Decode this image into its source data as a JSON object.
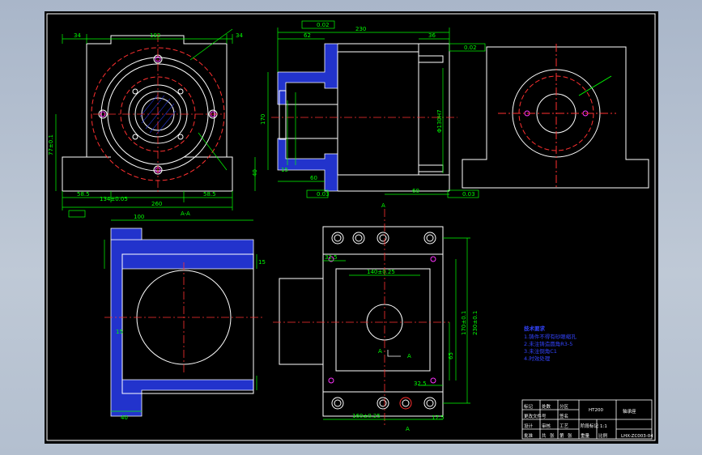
{
  "colors": {
    "background": "#b8c3d1",
    "sheet": "#000000",
    "outline": "#ffffff",
    "dimension": "#00ff00",
    "centerline": "#ff3030",
    "hatch": "#2233cc",
    "notes": "#3344ff",
    "callout": "#ffff00",
    "magenta": "#ff33ff"
  },
  "drawing": {
    "section_label": "A-A",
    "section_marker": "A",
    "front_view": {
      "dims": {
        "top_left": "34",
        "top_mid": "192",
        "top_right": "34",
        "bottom_left": "58.5",
        "bottom_mid": "134±0.05",
        "bottom_right": "58.5",
        "overall": "260",
        "left_height": "77±0.1",
        "right_height": "40"
      }
    },
    "side_view": {
      "dims": {
        "overall": "230",
        "top_left": "62",
        "top_right": "36",
        "bottom_left": "60",
        "bottom_right": "60",
        "small_left": "15",
        "bore": "Φ130H7",
        "left_height": "170"
      },
      "tolerance_top": "0.02",
      "tolerance_bottom_left": "0.03",
      "tolerance_bottom_right": "0.03"
    },
    "section_view": {
      "dims": {
        "top": "100",
        "bottom": "40",
        "side_left": "15",
        "side_right": "15"
      }
    },
    "top_view": {
      "dims": {
        "top_left": "32.5",
        "mid": "140±0.25",
        "bottom_right": "32.5",
        "bottom_mid": "160±0.25",
        "right_a": "170±0.1",
        "right_b": "230±0.1",
        "right_c": "65",
        "bottom_small": "17.5"
      }
    },
    "notes_title": "技术要求",
    "notes": [
      "1.铸件不得有砂眼缩孔",
      "2.未注铸造圆角R3-5",
      "3.未注倒角C1",
      "4.时效处理"
    ]
  },
  "title_block": {
    "part_name": "轴承座",
    "drawing_number": "LHX-ZC003-04",
    "material": "HT200",
    "scale": "1:1",
    "labels": [
      "标记",
      "处数",
      "分区",
      "更改文件号",
      "签名",
      "设计",
      "审核",
      "工艺",
      "批准",
      "阶段标记",
      "重量",
      "比例",
      "共",
      "张",
      "第",
      "张"
    ]
  }
}
